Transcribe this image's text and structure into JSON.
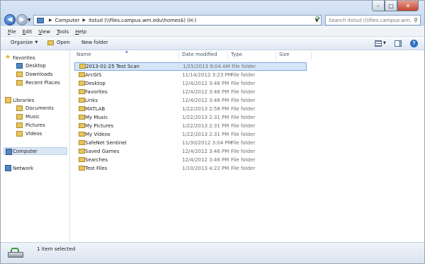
{
  "window": {
    "caption_buttons": [
      "minimize",
      "maximize",
      "close"
    ]
  },
  "address_bar": {
    "breadcrumbs": [
      "Computer",
      "itstud (\\\\files.campus.wm.edu\\homes$) (H:)"
    ],
    "search_placeholder": "Search itstud (\\\\files.campus.wm.edu\\..."
  },
  "menu": {
    "items": [
      "File",
      "Edit",
      "View",
      "Tools",
      "Help"
    ]
  },
  "toolbar": {
    "organize": "Organize",
    "open": "Open",
    "new_folder": "New folder"
  },
  "nav": {
    "favorites": {
      "label": "Favorites",
      "items": [
        "Desktop",
        "Downloads",
        "Recent Places"
      ]
    },
    "libraries": {
      "label": "Libraries",
      "items": [
        "Documents",
        "Music",
        "Pictures",
        "Videos"
      ]
    },
    "computer": "Computer",
    "network": "Network"
  },
  "columns": [
    "Name",
    "Date modified",
    "Type",
    "Size"
  ],
  "files": [
    {
      "name": "2013-01-25 Test Scan",
      "date": "1/25/2013 9:04 AM",
      "type": "File folder",
      "selected": true
    },
    {
      "name": "ArcGIS",
      "date": "11/14/2012 3:23 PM",
      "type": "File folder"
    },
    {
      "name": "Desktop",
      "date": "12/4/2012 3:46 PM",
      "type": "File folder"
    },
    {
      "name": "Favorites",
      "date": "12/4/2012 3:46 PM",
      "type": "File folder"
    },
    {
      "name": "Links",
      "date": "12/4/2012 3:46 PM",
      "type": "File folder"
    },
    {
      "name": "MATLAB",
      "date": "1/22/2013 2:58 PM",
      "type": "File folder"
    },
    {
      "name": "My Music",
      "date": "1/22/2013 2:31 PM",
      "type": "File folder"
    },
    {
      "name": "My Pictures",
      "date": "1/22/2013 2:31 PM",
      "type": "File folder"
    },
    {
      "name": "My Videos",
      "date": "1/22/2013 2:31 PM",
      "type": "File folder"
    },
    {
      "name": "SafeNet Sentinel",
      "date": "11/30/2012 3:04 PM",
      "type": "File folder"
    },
    {
      "name": "Saved Games",
      "date": "12/4/2012 3:46 PM",
      "type": "File folder"
    },
    {
      "name": "Searches",
      "date": "12/4/2012 3:46 PM",
      "type": "File folder"
    },
    {
      "name": "Test Files",
      "date": "1/10/2013 4:22 PM",
      "type": "File folder"
    }
  ],
  "status": {
    "text": "1 item selected"
  }
}
